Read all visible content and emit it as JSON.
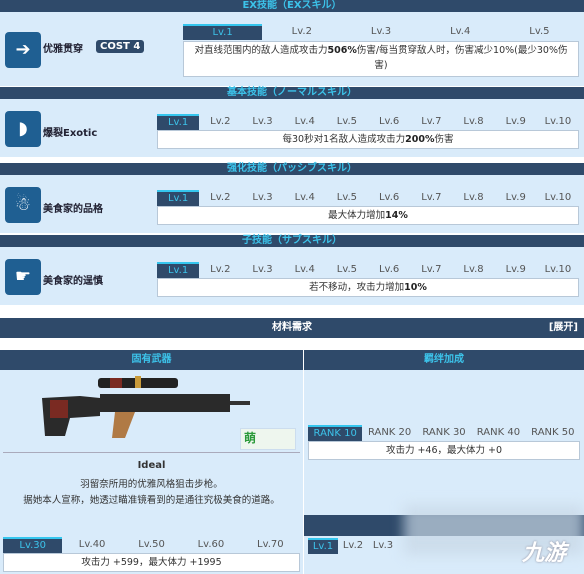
{
  "skills": [
    {
      "header": "EX技能（EXスキル）",
      "name": "优雅贯穿",
      "cost": "COST 4",
      "icon": "arrow-pierce-icon",
      "tabs": [
        "Lv.1",
        "Lv.2",
        "Lv.3",
        "Lv.4",
        "Lv.5"
      ],
      "desc_pre": "对直线范围内的敌人造成攻击力",
      "desc_bold": "506%",
      "desc_post": "伤害/每当贯穿敌人时，伤害减少10%(最少30%伤害)"
    },
    {
      "header": "基本技能（ノーマルスキル）",
      "name": "爆裂Exotic",
      "icon": "bullet-burst-icon",
      "tabs": [
        "Lv.1",
        "Lv.2",
        "Lv.3",
        "Lv.4",
        "Lv.5",
        "Lv.6",
        "Lv.7",
        "Lv.8",
        "Lv.9",
        "Lv.10"
      ],
      "desc_pre": "每30秒对1名敌人造成攻击力",
      "desc_bold": "200%",
      "desc_post": "伤害"
    },
    {
      "header": "强化技能（パッシブスキル）",
      "name": "美食家的品格",
      "icon": "gourmet-icon",
      "tabs": [
        "Lv.1",
        "Lv.2",
        "Lv.3",
        "Lv.4",
        "Lv.5",
        "Lv.6",
        "Lv.7",
        "Lv.8",
        "Lv.9",
        "Lv.10"
      ],
      "desc_pre": "最大体力增加",
      "desc_bold": "14%",
      "desc_post": ""
    },
    {
      "header": "子技能（サブスキル）",
      "name": "美食家的逞慎",
      "icon": "pistol-icon",
      "tabs": [
        "Lv.1",
        "Lv.2",
        "Lv.3",
        "Lv.4",
        "Lv.5",
        "Lv.6",
        "Lv.7",
        "Lv.8",
        "Lv.9",
        "Lv.10"
      ],
      "desc_pre": "若不移动，攻击力增加",
      "desc_bold": "10%",
      "desc_post": ""
    }
  ],
  "materials": {
    "title": "材料需求",
    "expand": "[展开]"
  },
  "weapon": {
    "header": "固有武器",
    "name": "Ideal",
    "desc1": "羽留奈所用的优雅风格狙击步枪。",
    "desc2": "据她本人宣称，她透过瞄准镜看到的是通往究极美食的道路。",
    "watermark": "萌",
    "tabs": [
      "Lv.30",
      "Lv.40",
      "Lv.50",
      "Lv.60",
      "Lv.70"
    ],
    "stat": "攻击力 +599，最大体力 +1995"
  },
  "bond": {
    "header": "羁绊加成",
    "tabs": [
      "RANK 10",
      "RANK 20",
      "RANK 30",
      "RANK 40",
      "RANK 50"
    ],
    "stat": "攻击力 +46，最大体力 +0",
    "tabs2": [
      "Lv.1",
      "Lv.2",
      "Lv.3"
    ]
  },
  "site_watermark": "九游",
  "colors": {
    "header_bg": "#2f4a6a",
    "header_text": "#3cc3ea",
    "panel_bg": "#d9ebfa"
  }
}
